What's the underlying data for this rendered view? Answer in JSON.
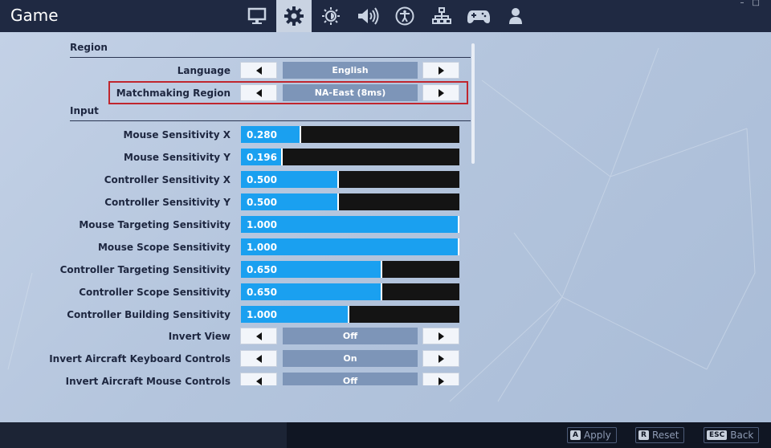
{
  "window": {
    "title": "Game",
    "controls": [
      "–",
      "□"
    ]
  },
  "tabs": [
    {
      "name": "video",
      "icon": "monitor-icon",
      "active": false
    },
    {
      "name": "game",
      "icon": "gear-icon",
      "active": true
    },
    {
      "name": "brightness",
      "icon": "brightness-icon",
      "active": false
    },
    {
      "name": "audio",
      "icon": "speaker-icon",
      "active": false
    },
    {
      "name": "accessibility",
      "icon": "accessibility-icon",
      "active": false
    },
    {
      "name": "input",
      "icon": "network-icon",
      "active": false
    },
    {
      "name": "controller",
      "icon": "gamepad-icon",
      "active": false
    },
    {
      "name": "account",
      "icon": "person-icon",
      "active": false
    }
  ],
  "sections": {
    "region": "Region",
    "input": "Input"
  },
  "region_settings": [
    {
      "label": "Language",
      "value": "English"
    },
    {
      "label": "Matchmaking Region",
      "value": "NA-East (8ms)"
    }
  ],
  "input_sliders": [
    {
      "label": "Mouse Sensitivity X",
      "value": "0.280",
      "fraction": 0.27
    },
    {
      "label": "Mouse Sensitivity Y",
      "value": "0.196",
      "fraction": 0.185
    },
    {
      "label": "Controller Sensitivity X",
      "value": "0.500",
      "fraction": 0.44
    },
    {
      "label": "Controller Sensitivity Y",
      "value": "0.500",
      "fraction": 0.44
    },
    {
      "label": "Mouse Targeting Sensitivity",
      "value": "1.000",
      "fraction": 1.0
    },
    {
      "label": "Mouse Scope Sensitivity",
      "value": "1.000",
      "fraction": 1.0
    },
    {
      "label": "Controller Targeting Sensitivity",
      "value": "0.650",
      "fraction": 0.64
    },
    {
      "label": "Controller Scope Sensitivity",
      "value": "0.650",
      "fraction": 0.64
    },
    {
      "label": "Controller Building Sensitivity",
      "value": "1.000",
      "fraction": 0.49
    }
  ],
  "input_toggles": [
    {
      "label": "Invert View",
      "value": "Off"
    },
    {
      "label": "Invert Aircraft Keyboard Controls",
      "value": "On"
    },
    {
      "label": "Invert Aircraft Mouse Controls",
      "value": "Off"
    }
  ],
  "footer": {
    "apply": {
      "key": "A",
      "label": "Apply"
    },
    "reset": {
      "key": "R",
      "label": "Reset"
    },
    "back": {
      "key": "ESC",
      "label": "Back"
    }
  },
  "colors": {
    "topbar": "#1f2942",
    "slider_fill": "#1aa0f0",
    "highlight": "#c0262e",
    "value_box": "#7d95b8"
  }
}
